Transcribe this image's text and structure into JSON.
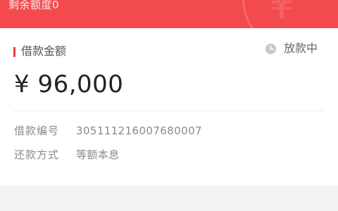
{
  "banner": {
    "text": "剩余额度0"
  },
  "loan": {
    "title": "借款金额",
    "status": "放款中",
    "amount": "¥ 96,000"
  },
  "details": [
    {
      "label": "借款编号",
      "value": "305111216007680007"
    },
    {
      "label": "还款方式",
      "value": "等额本息"
    }
  ],
  "colors": {
    "brand_red": "#f34a4e",
    "accent": "#e8413e",
    "background": "#f2f2f4"
  }
}
